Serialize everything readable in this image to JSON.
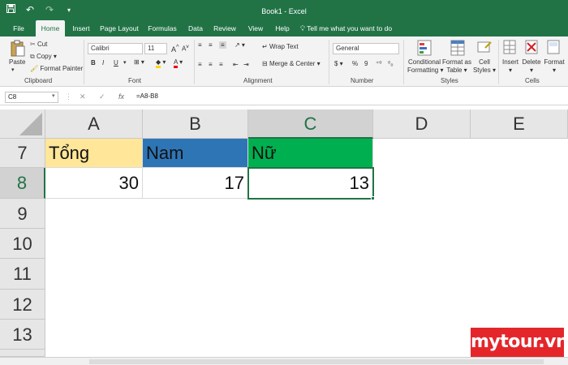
{
  "window": {
    "title": "Book1  -  Excel"
  },
  "qat": {
    "save_icon": "save-icon",
    "undo_icon": "undo-icon",
    "redo_icon": "redo-icon",
    "customize_icon": "customize-icon"
  },
  "tabs": [
    "File",
    "Home",
    "Insert",
    "Page Layout",
    "Formulas",
    "Data",
    "Review",
    "View",
    "Help",
    "Tell me what you want to do"
  ],
  "ribbon": {
    "clipboard": {
      "paste": "Paste",
      "cut": "Cut",
      "copy": "Copy",
      "format_painter": "Format Painter",
      "label": "Clipboard"
    },
    "font": {
      "name": "Calibri",
      "size": "11",
      "bold": "B",
      "italic": "I",
      "underline": "U",
      "grow": "A",
      "shrink": "A",
      "label": "Font"
    },
    "alignment": {
      "wrap_text": "Wrap Text",
      "merge_center": "Merge & Center",
      "label": "Alignment"
    },
    "number": {
      "format": "General",
      "currency": "$",
      "percent": "%",
      "comma": "9",
      "label": "Number"
    },
    "styles": {
      "conditional_1": "Conditional",
      "conditional_2": "Formatting",
      "format_table_1": "Format as",
      "format_table_2": "Table",
      "cell_styles_1": "Cell",
      "cell_styles_2": "Styles",
      "label": "Styles"
    },
    "cells": {
      "insert": "Insert",
      "delete": "Delete",
      "format": "Format",
      "label": "Cells"
    }
  },
  "formula_bar": {
    "name_box": "C8",
    "cancel": "✕",
    "enter": "✓",
    "fx": "fx",
    "formula": "=A8-B8"
  },
  "grid": {
    "columns": [
      "A",
      "B",
      "C",
      "D",
      "E"
    ],
    "selected_column": "C",
    "rows": [
      "7",
      "8",
      "9",
      "10",
      "11",
      "12",
      "13"
    ],
    "selected_row": "8",
    "cells": {
      "A7": "Tổng",
      "B7": "Nam",
      "C7": "Nữ",
      "A8": "30",
      "B8": "17",
      "C8": "13"
    },
    "fills": {
      "A7": "#FFE699",
      "B7": "#2E75B6",
      "C7": "#00B050"
    }
  },
  "watermark": "mytour.vn"
}
